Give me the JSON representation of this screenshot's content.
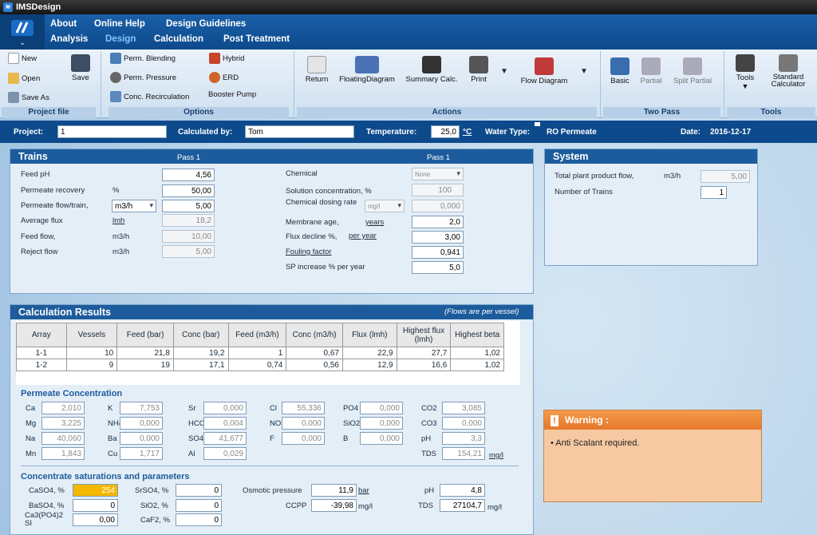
{
  "app": {
    "title": "IMSDesign"
  },
  "menu": {
    "top": [
      "About",
      "Online Help",
      "Design Guidelines"
    ],
    "bottom": [
      "Analysis",
      "Design",
      "Calculation",
      "Post Treatment"
    ]
  },
  "ribbon": {
    "project": {
      "new": "New",
      "open": "Open",
      "save_as": "Save As",
      "save": "Save",
      "group": "Project file"
    },
    "options": {
      "perm_blending": "Perm. Blending",
      "perm_pressure": "Perm. Pressure",
      "conc_recirc": "Conc. Recirculation",
      "hybrid": "Hybrid",
      "erd": "ERD",
      "booster": "Booster Pump",
      "group": "Options"
    },
    "actions": {
      "return": "Return",
      "floating": "FloatingDiagram",
      "summary": "Summary Calc.",
      "print": "Print",
      "flow": "Flow Diagram",
      "group": "Actions"
    },
    "twopass": {
      "basic": "Basic",
      "partial": "Partial",
      "split": "Split Partial",
      "group": "Two Pass"
    },
    "tools": {
      "tools": "Tools",
      "std_calc": "Standard Calculator",
      "group": "Tools"
    }
  },
  "project": {
    "label": "Project:",
    "value": "1",
    "calc_by_label": "Calculated by:",
    "calc_by": "Tom",
    "temp_label": "Temperature:",
    "temp": "25,0",
    "temp_unit": "°C",
    "water_label": "Water Type:",
    "water": "RO Permeate",
    "date_label": "Date:",
    "date": "2016-12-17"
  },
  "trains": {
    "title": "Trains",
    "pass1": "Pass 1",
    "pass1b": "Pass 1",
    "feed_ph": {
      "label": "Feed pH",
      "value": "4,56"
    },
    "recovery": {
      "label": "Permeate recovery",
      "unit": "%",
      "value": "50,00"
    },
    "flow_train": {
      "label": "Permeate flow/train,",
      "unit": "m3/h",
      "value": "5,00"
    },
    "avg_flux": {
      "label": "Average flux",
      "unit": "lmh",
      "value": "18,2"
    },
    "feed_flow": {
      "label": "Feed flow,",
      "unit": "m3/h",
      "value": "10,00"
    },
    "reject": {
      "label": "Reject flow",
      "unit": "m3/h",
      "value": "5,00"
    },
    "chemical": {
      "label": "Chemical",
      "value": "None"
    },
    "sol_conc": {
      "label": "Solution concentration, %",
      "value": "100"
    },
    "dosing": {
      "label": "Chemical dosing rate",
      "unit": "mg/l",
      "value": "0,000"
    },
    "mem_age": {
      "label": "Membrane age,",
      "unit": "years",
      "value": "2,0"
    },
    "flux_decline": {
      "label": "Flux decline %,",
      "unit": "per year",
      "value": "3,00"
    },
    "fouling": {
      "label": "Fouling factor",
      "value": "0,941"
    },
    "sp_inc": {
      "label": "SP increase % per year",
      "value": "5,0"
    }
  },
  "system": {
    "title": "System",
    "total_label": "Total plant product flow,",
    "total_unit": "m3/h",
    "total": "5,00",
    "trains_label": "Number of Trains",
    "trains": "1"
  },
  "results": {
    "title": "Calculation Results",
    "note": "(Flows are per vessel)",
    "headers": [
      "Array",
      "Vessels",
      "Feed (bar)",
      "Conc (bar)",
      "Feed (m3/h)",
      "Conc (m3/h)",
      "Flux (lmh)",
      "Highest flux (lmh)",
      "Highest beta"
    ],
    "rows": [
      [
        "1-1",
        "10",
        "21,8",
        "19,2",
        "1",
        "0,67",
        "22,9",
        "27,7",
        "1,02"
      ],
      [
        "1-2",
        "9",
        "19",
        "17,1",
        "0,74",
        "0,56",
        "12,9",
        "16,6",
        "1,02"
      ]
    ]
  },
  "permeate": {
    "title": "Permeate Concentration",
    "unit": "mg/l",
    "items": [
      [
        "Ca",
        "2,010"
      ],
      [
        "K",
        "7,753"
      ],
      [
        "Sr",
        "0,000"
      ],
      [
        "Cl",
        "55,336"
      ],
      [
        "PO4",
        "0,000"
      ],
      [
        "CO2",
        "3,085"
      ],
      [
        "Mg",
        "3,225"
      ],
      [
        "NH4",
        "0,000"
      ],
      [
        "HCO3",
        "0,004"
      ],
      [
        "NO3",
        "0,000"
      ],
      [
        "SiO2",
        "0,000"
      ],
      [
        "CO3",
        "0,000"
      ],
      [
        "Na",
        "40,060"
      ],
      [
        "Ba",
        "0,000"
      ],
      [
        "SO4",
        "41,677"
      ],
      [
        "F",
        "0,000"
      ],
      [
        "B",
        "0,000"
      ],
      [
        "pH",
        "3,3"
      ],
      [
        "Mn",
        "1,843"
      ],
      [
        "Cu",
        "1,717"
      ],
      [
        "Al",
        "0,029"
      ],
      [
        "TDS",
        "154,21"
      ]
    ]
  },
  "concentrate": {
    "title": "Concentrate saturations and parameters",
    "caso4": {
      "label": "CaSO4, %",
      "value": "254"
    },
    "srso4": {
      "label": "SrSO4, %",
      "value": "0"
    },
    "baso4": {
      "label": "BaSO4, %",
      "value": "0"
    },
    "sio2": {
      "label": "SiO2, %",
      "value": "0"
    },
    "capo4": {
      "label": "Ca3(PO4)2 SI",
      "value": "0,00"
    },
    "caf2": {
      "label": "CaF2, %",
      "value": "0"
    },
    "osm": {
      "label": "Osmotic pressure",
      "value": "11,9",
      "unit": "bar"
    },
    "ccpp": {
      "label": "CCPP",
      "value": "-39,98",
      "unit": "mg/l"
    },
    "ph": {
      "label": "pH",
      "value": "4,8"
    },
    "tds": {
      "label": "TDS",
      "value": "27104,7",
      "unit": "mg/l"
    }
  },
  "warning": {
    "title": "Warning :",
    "message": "• Anti Scalant required."
  },
  "colors": {
    "header_blue": "#0d4a8c",
    "warning_orange": "#e4782a",
    "highlight": "#f5b800"
  }
}
